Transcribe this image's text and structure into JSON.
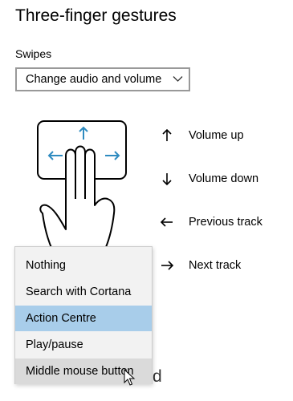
{
  "title": "Three-finger gestures",
  "swipes": {
    "label": "Swipes",
    "selected": "Change audio and volume"
  },
  "gestures": [
    {
      "icon": "arrow-up-icon",
      "label": "Volume up"
    },
    {
      "icon": "arrow-down-icon",
      "label": "Volume down"
    },
    {
      "icon": "arrow-left-icon",
      "label": "Previous track"
    },
    {
      "icon": "arrow-right-icon",
      "label": "Next track"
    }
  ],
  "dropdown": {
    "options": [
      "Nothing",
      "Search with Cortana",
      "Action Centre",
      "Play/pause",
      "Middle mouse button"
    ],
    "selected_index": 2,
    "hover_index": 4
  },
  "obscured_text_fragment": "d",
  "colors": {
    "accent": "#2e8bc0",
    "selected_bg": "#a8cdea",
    "hover_bg": "#dadada",
    "popup_bg": "#f2f2f2"
  }
}
